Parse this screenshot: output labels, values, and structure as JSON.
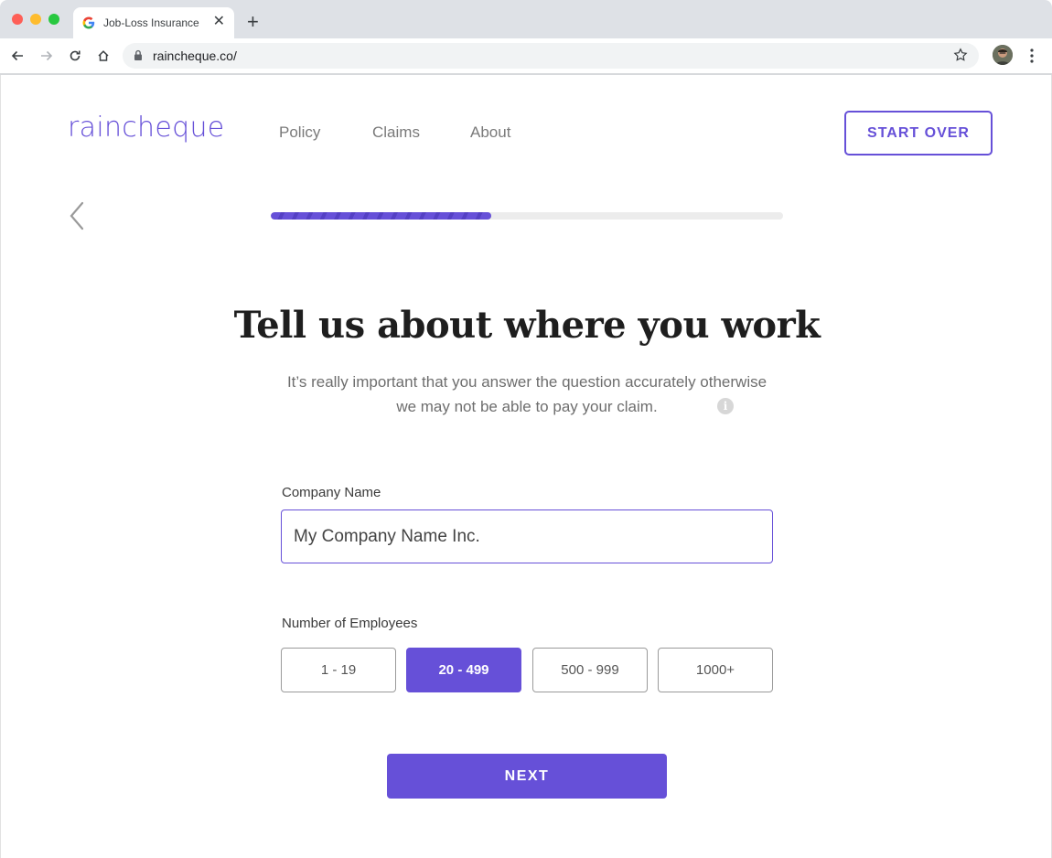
{
  "browser": {
    "tab_title": "Job-Loss Insurance",
    "url": "raincheque.co/"
  },
  "header": {
    "logo": "raincheque",
    "nav": [
      "Policy",
      "Claims",
      "About"
    ],
    "start_over_label": "START OVER"
  },
  "progress": {
    "fraction": 0.43
  },
  "main": {
    "heading": "Tell us about where you work",
    "subtext": "It’s really important that you answer the question accurately otherwise we may not be able to pay your claim.",
    "info_icon_glyph": "i"
  },
  "form": {
    "company_label": "Company Name",
    "company_value": "My Company Name Inc.",
    "employees_label": "Number of Employees",
    "employee_options": [
      "1 - 19",
      "20 - 499",
      "500 - 999",
      "1000+"
    ],
    "selected_employee_option": "20 - 499",
    "next_label": "NEXT"
  },
  "colors": {
    "brand": "#6650d8",
    "text_dark": "#1e1e1e",
    "text_muted": "#6e6e6e"
  }
}
